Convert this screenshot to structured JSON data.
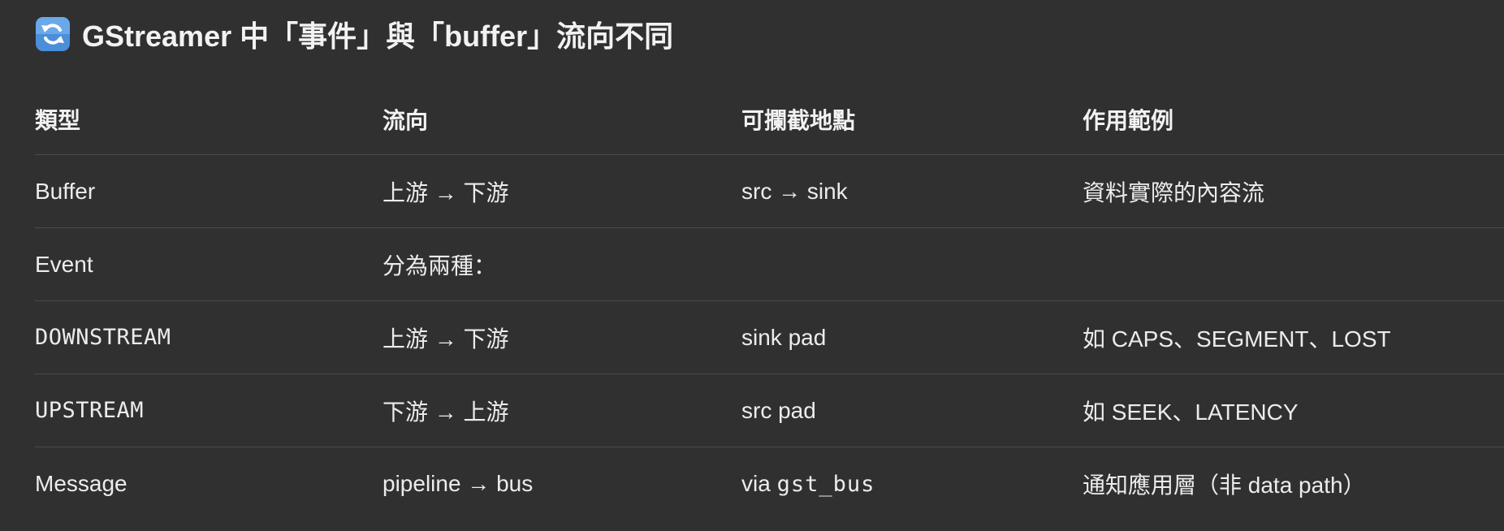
{
  "heading": {
    "icon": "arrows-counterclockwise-icon",
    "text": "GStreamer 中「事件」與「buffer」流向不同"
  },
  "table": {
    "headers": [
      "類型",
      "流向",
      "可攔截地點",
      "作用範例"
    ],
    "rows": [
      {
        "type": "Buffer",
        "flow": "上游 → 下游",
        "intercept": "src → sink",
        "example": "資料實際的內容流"
      },
      {
        "type": "Event",
        "flow": "分為兩種：",
        "intercept": "",
        "example": ""
      },
      {
        "type": "DOWNSTREAM",
        "flow": "上游 → 下游",
        "intercept": "sink pad",
        "example": "如 CAPS、SEGMENT、LOST"
      },
      {
        "type": "UPSTREAM",
        "flow": "下游 → 上游",
        "intercept": "src pad",
        "example": "如 SEEK、LATENCY"
      },
      {
        "type": "Message",
        "flow": "pipeline → bus",
        "intercept_prefix": "via ",
        "intercept_code": "gst_bus",
        "example": "通知應用層（非 data path）"
      }
    ]
  },
  "colors": {
    "background": "#303030",
    "icon_bg": "#4a8fd8",
    "divider": "#4a4a4a"
  }
}
